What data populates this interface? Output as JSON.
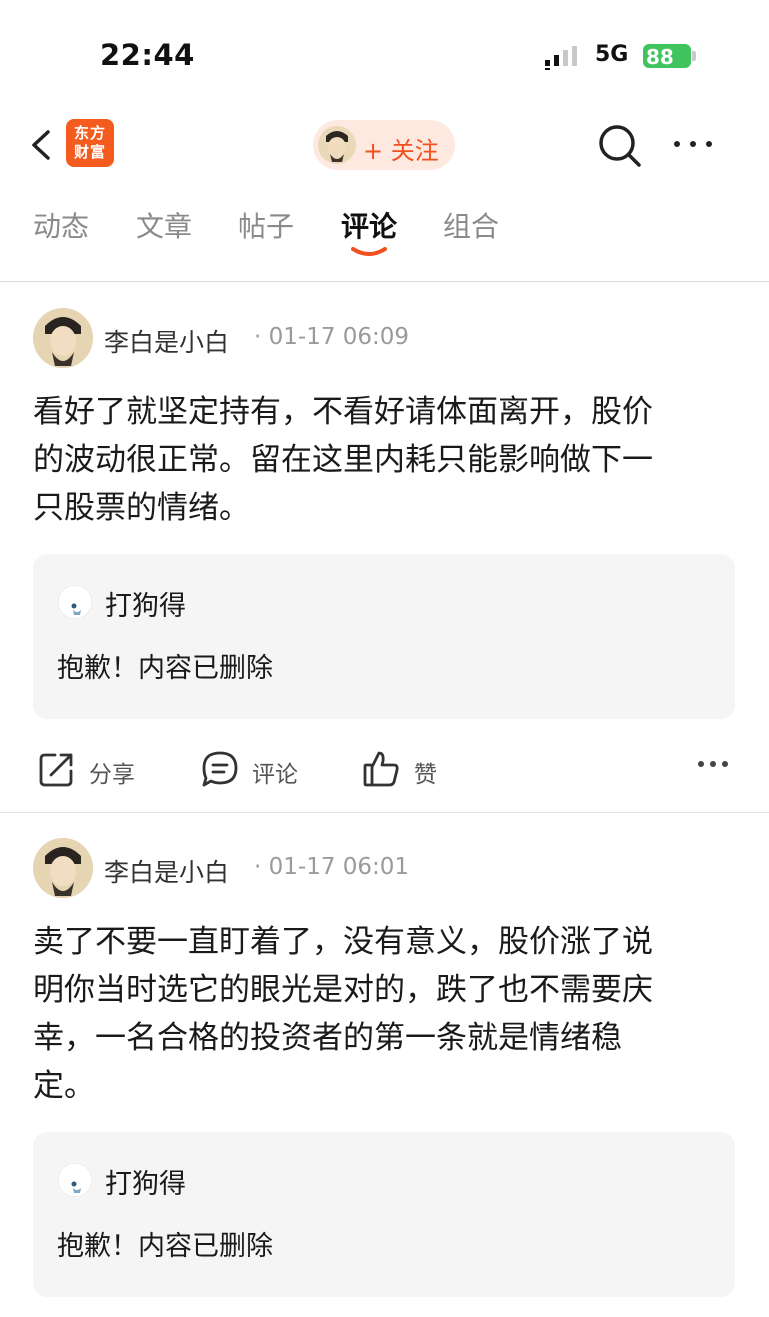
{
  "status_bar": {
    "time": "22:44",
    "network": "5G",
    "battery": "88"
  },
  "nav": {
    "logo_line1": "东方",
    "logo_line2": "财富",
    "follow_label": "+ 关注"
  },
  "tabs": [
    {
      "label": "动态"
    },
    {
      "label": "文章"
    },
    {
      "label": "帖子"
    },
    {
      "label": "评论"
    },
    {
      "label": "组合"
    }
  ],
  "active_tab": "评论",
  "posts": [
    {
      "author": "李白是小白",
      "timestamp": "· 01-17 06:09",
      "content_lines": [
        "看好了就坚定持有，不看好请体面离开，股价",
        "的波动很正常。留在这里内耗只能影响做下一",
        "只股票的情绪。"
      ],
      "quote": {
        "author": "打狗得",
        "text": "抱歉！内容已删除"
      },
      "actions": {
        "share": "分享",
        "comment": "评论",
        "like": "赞"
      }
    },
    {
      "author": "李白是小白",
      "timestamp": "· 01-17 06:01",
      "content_lines": [
        "卖了不要一直盯着了，没有意义，股价涨了说",
        "明你当时选它的眼光是对的，跌了也不需要庆",
        "幸，一名合格的投资者的第一条就是情绪稳",
        "定。"
      ],
      "quote": {
        "author": "打狗得",
        "text": "抱歉！内容已删除"
      }
    }
  ],
  "colors": {
    "accent": "#f0501e",
    "follow_bg": "#fde9df",
    "quote_bg": "#f5f5f5",
    "battery": "#3fc45e"
  }
}
